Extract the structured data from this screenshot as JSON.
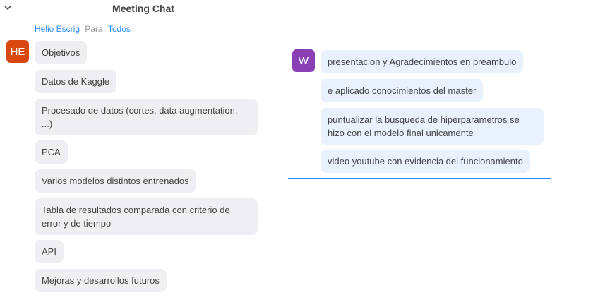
{
  "header": {
    "title": "Meeting Chat"
  },
  "sender_line": {
    "from": "Helio Escrig",
    "to_word": "Para",
    "recipient": "Todos"
  },
  "left_thread": {
    "avatar_initials": "HE",
    "avatar_color": "#d9480f",
    "messages": [
      "Objetivos",
      "Datos de Kaggle",
      "Procesado de datos (cortes, data augmentation, ...)",
      "PCA",
      "Varios modelos distintos entrenados",
      "Tabla de resultados comparada con criterio de error y de tiempo",
      "API",
      "Mejoras y desarrollos futuros"
    ]
  },
  "right_thread": {
    "avatar_initials": "W",
    "avatar_color": "#8a3fb4",
    "messages": [
      "presentacion y  Agradecimientos en preambulo",
      "e aplicado conocimientos del master",
      "puntualizar la busqueda de hiperparametros se hizo con el modelo final unicamente",
      "video youtube con evidencia del funcionamiento"
    ]
  },
  "colors": {
    "accent": "#2d8cff",
    "left_bubble": "#efeef2",
    "right_bubble": "#e8f1fd"
  }
}
